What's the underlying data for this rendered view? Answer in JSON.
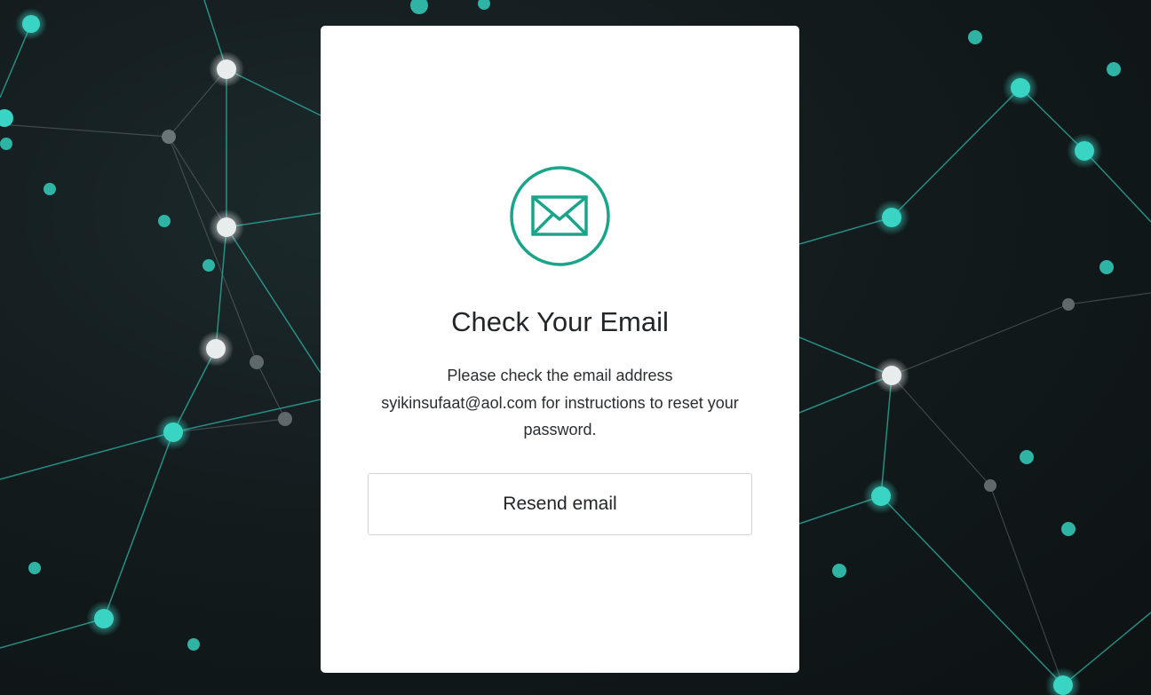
{
  "card": {
    "icon": "envelope-icon",
    "title": "Check Your Email",
    "message_line1": "Please check the email address",
    "email": "syikinsufaat@aol.com",
    "message_line2_suffix": " for instructions to reset your",
    "message_line3": "password.",
    "resend_label": "Resend email"
  },
  "colors": {
    "accent": "#1aa58a",
    "background": "#131b1d",
    "card": "#ffffff",
    "node_teal": "#35d1c0",
    "node_white": "#e8ecec"
  }
}
